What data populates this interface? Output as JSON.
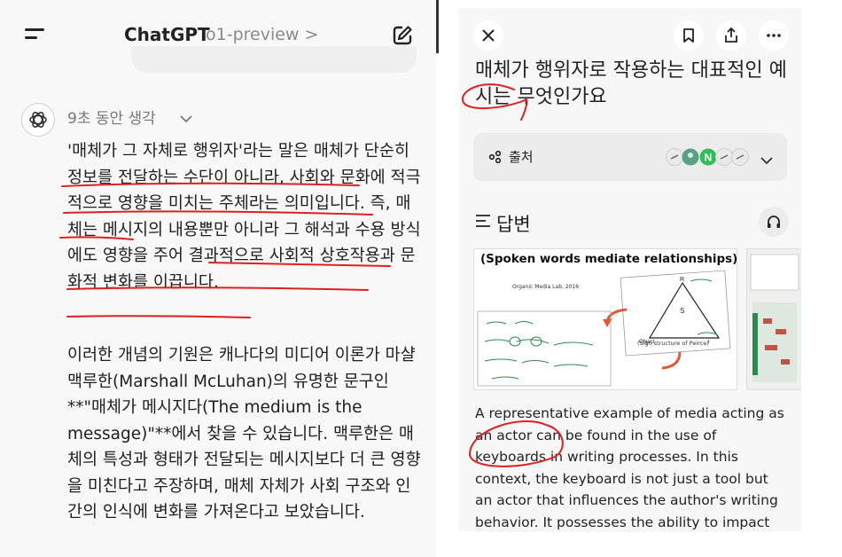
{
  "left": {
    "title": "ChatGPT",
    "model": "o1-preview >",
    "thinking_label": "9초 동안 생각",
    "paragraph1": "'매체가 그 자체로 행위자'라는 말은 매체가 단순히 정보를 전달하는 수단이 아니라, 사회와 문화에 적극적으로 영향을 미치는 주체라는 의미입니다. 즉, 매체는 메시지의 내용뿐만 아니라 그 해석과 수용 방식에도 영향을 주어 결과적으로 사회적 상호작용과 문화적 변화를 이끕니다.",
    "paragraph2": "이러한 개념의 기원은 캐나다의 미디어 이론가 마샬 맥루한(Marshall McLuhan)의 유명한 문구인 **\"매체가 메시지다(The medium is the message)\"**에서 찾을 수 있습니다. 맥루한은 매체의 특성과 형태가 전달되는 메시지보다 더 큰 영향을 미친다고 주장하며, 매체 자체가 사회 구조와 인간의 인식에 변화를 가져온다고 보았습니다."
  },
  "right": {
    "question": "매체가 행위자로 작용하는 대표적인 예시는 무엇인가요",
    "sources_label": "출처",
    "source_badge": "N",
    "answer_label": "답변",
    "image": {
      "title": "(Spoken words mediate relationships)",
      "subtitle": "Organic Media Lab, 2016",
      "caption": "(Sign structure of Peirce)"
    },
    "body": "A representative example of media acting as an actor can be found in the use of keyboards in writing processes. In this context, the keyboard is not just a tool but an actor that influences the author's writing behavior. It possesses the ability to impact"
  },
  "colors": {
    "annotation_red": "#e02020",
    "accent_green": "#2e9e5b"
  }
}
